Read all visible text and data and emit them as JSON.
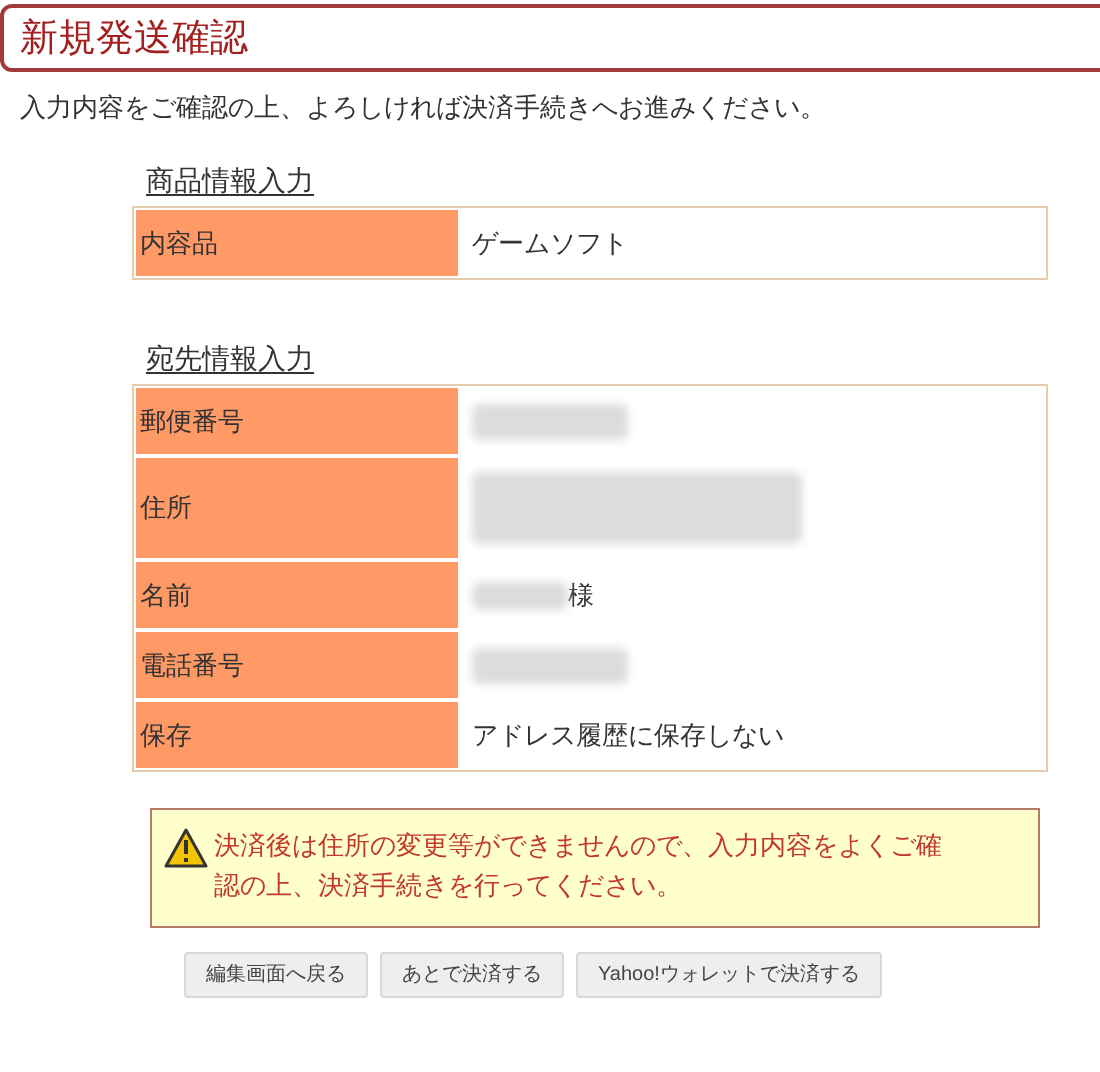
{
  "page": {
    "title": "新規発送確認",
    "intro": "入力内容をご確認の上、よろしければ決済手続きへお進みください。"
  },
  "sections": [
    {
      "heading": "商品情報入力",
      "rows": [
        {
          "label": "内容品",
          "kind": "text",
          "value": "ゲームソフト"
        }
      ]
    },
    {
      "heading": "宛先情報入力",
      "rows": [
        {
          "label": "郵便番号",
          "kind": "redacted"
        },
        {
          "label": "住所",
          "kind": "redacted_tall"
        },
        {
          "label": "名前",
          "kind": "redacted_name",
          "value": "様"
        },
        {
          "label": "電話番号",
          "kind": "redacted"
        },
        {
          "label": "保存",
          "kind": "text",
          "value": "アドレス履歴に保存しない"
        }
      ]
    }
  ],
  "warning": {
    "text": "決済後は住所の変更等ができませんので、入力内容をよくご確認の上、決済手続きを行ってください。"
  },
  "buttons": [
    "編集画面へ戻る",
    "あとで決済する",
    "Yahoo!ウォレットで決済する"
  ]
}
